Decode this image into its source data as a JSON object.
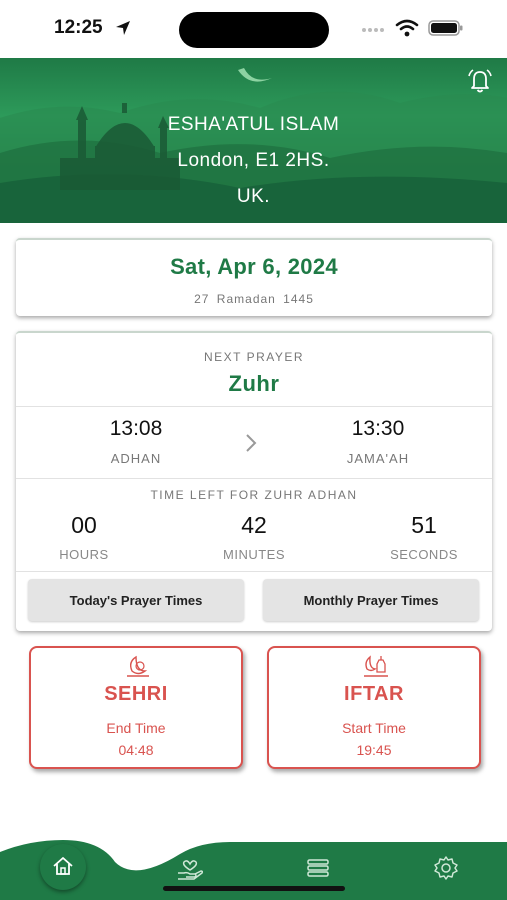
{
  "status_bar": {
    "time": "12:25"
  },
  "header": {
    "line1": "ESHA'ATUL ISLAM",
    "line2": "London, E1 2HS.",
    "line3": "UK."
  },
  "date_card": {
    "gregorian": "Sat, Apr 6, 2024",
    "hijri": "27 Ramadan 1445"
  },
  "next_prayer": {
    "label": "NEXT PRAYER",
    "name": "Zuhr",
    "adhan_time": "13:08",
    "adhan_label": "ADHAN",
    "jamaah_time": "13:30",
    "jamaah_label": "JAMA'AH"
  },
  "countdown": {
    "label": "TIME LEFT FOR ZUHR ADHAN",
    "hours": "00",
    "hours_label": "HOURS",
    "minutes": "42",
    "minutes_label": "MINUTES",
    "seconds": "51",
    "seconds_label": "SECONDS"
  },
  "buttons": {
    "today": "Today's Prayer Times",
    "monthly": "Monthly Prayer Times"
  },
  "sehri": {
    "title": "SEHRI",
    "subtitle": "End Time",
    "time": "04:48"
  },
  "iftar": {
    "title": "IFTAR",
    "subtitle": "Start Time",
    "time": "19:45"
  },
  "icons": {
    "status": [
      "location-arrow-icon",
      "signal-dots-icon",
      "wifi-icon",
      "battery-icon"
    ],
    "header": [
      "mosque-silhouette",
      "crescent-moon",
      "bell-icon"
    ],
    "cards": [
      "crescent-plate-icon",
      "lantern-moon-icon",
      "chevron-right-icon"
    ],
    "nav": [
      "home-icon",
      "donate-hand-heart-icon",
      "list-icon",
      "gear-icon"
    ]
  },
  "colors": {
    "brand_green": "#1f7a46",
    "accent_red": "#d9534f"
  }
}
